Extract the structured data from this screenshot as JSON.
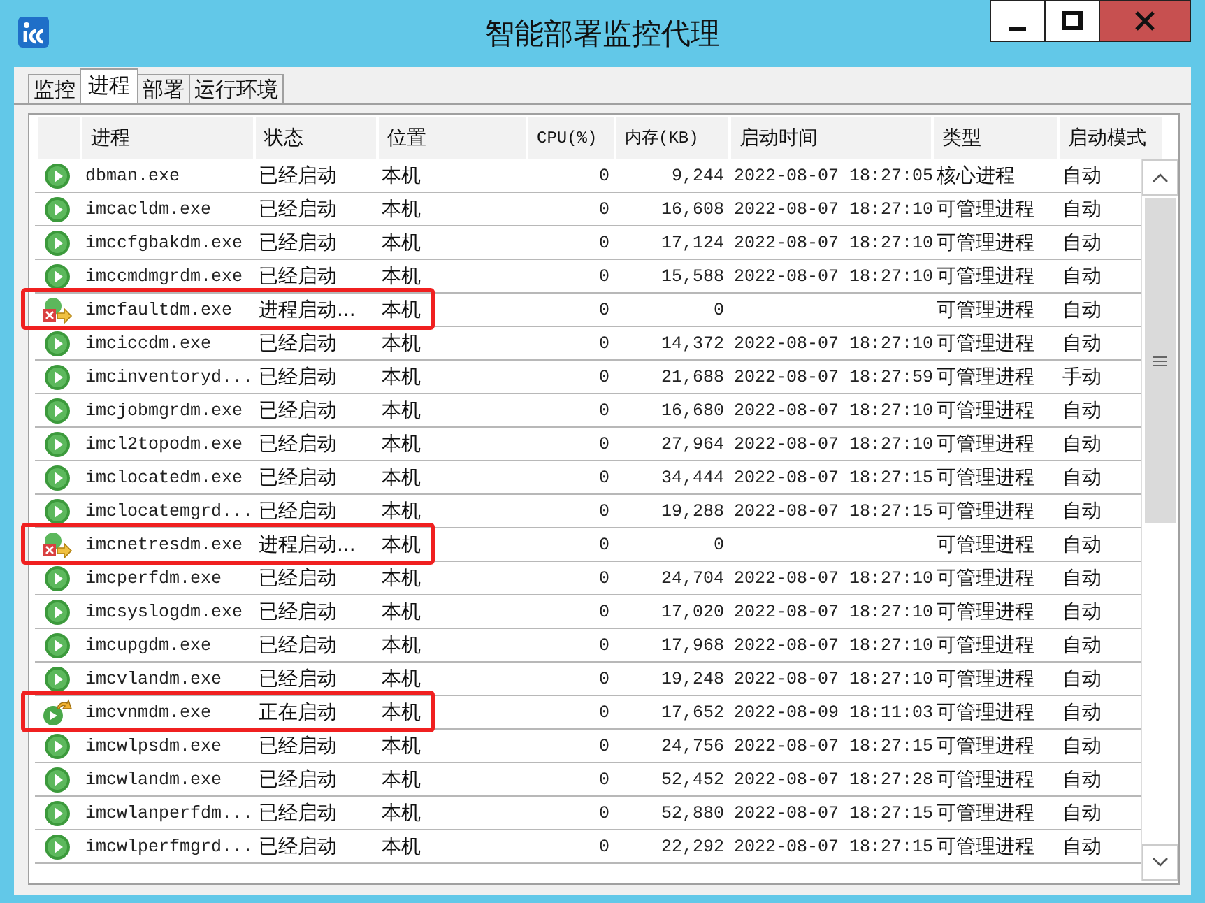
{
  "window": {
    "title": "智能部署监控代理"
  },
  "tabs": [
    {
      "label": "监控",
      "selected": false
    },
    {
      "label": "进程",
      "selected": true
    },
    {
      "label": "部署",
      "selected": false
    },
    {
      "label": "运行环境",
      "selected": false
    }
  ],
  "table": {
    "columns": [
      "进程",
      "状态",
      "位置",
      "CPU(%)",
      "内存(KB)",
      "启动时间",
      "类型",
      "启动模式"
    ],
    "rows": [
      {
        "kind": "running",
        "highlighted": false,
        "cells": [
          "dbman.exe",
          "已经启动",
          "本机",
          "0",
          "9,244",
          "2022-08-07 18:27:05",
          "核心进程",
          "自动"
        ]
      },
      {
        "kind": "running",
        "highlighted": false,
        "cells": [
          "imcacldm.exe",
          "已经启动",
          "本机",
          "0",
          "16,608",
          "2022-08-07 18:27:10",
          "可管理进程",
          "自动"
        ]
      },
      {
        "kind": "running",
        "highlighted": false,
        "cells": [
          "imccfgbakdm.exe",
          "已经启动",
          "本机",
          "0",
          "17,124",
          "2022-08-07 18:27:10",
          "可管理进程",
          "自动"
        ]
      },
      {
        "kind": "running",
        "highlighted": false,
        "cells": [
          "imccmdmgrdm.exe",
          "已经启动",
          "本机",
          "0",
          "15,588",
          "2022-08-07 18:27:10",
          "可管理进程",
          "自动"
        ]
      },
      {
        "kind": "failed",
        "highlighted": true,
        "cells": [
          "imcfaultdm.exe",
          "进程启动...",
          "本机",
          "0",
          "0",
          "",
          "可管理进程",
          "自动"
        ]
      },
      {
        "kind": "running",
        "highlighted": false,
        "cells": [
          "imciccdm.exe",
          "已经启动",
          "本机",
          "0",
          "14,372",
          "2022-08-07 18:27:10",
          "可管理进程",
          "自动"
        ]
      },
      {
        "kind": "running",
        "highlighted": false,
        "cells": [
          "imcinventoryd...",
          "已经启动",
          "本机",
          "0",
          "21,688",
          "2022-08-07 18:27:59",
          "可管理进程",
          "手动"
        ]
      },
      {
        "kind": "running",
        "highlighted": false,
        "cells": [
          "imcjobmgrdm.exe",
          "已经启动",
          "本机",
          "0",
          "16,680",
          "2022-08-07 18:27:10",
          "可管理进程",
          "自动"
        ]
      },
      {
        "kind": "running",
        "highlighted": false,
        "cells": [
          "imcl2topodm.exe",
          "已经启动",
          "本机",
          "0",
          "27,964",
          "2022-08-07 18:27:10",
          "可管理进程",
          "自动"
        ]
      },
      {
        "kind": "running",
        "highlighted": false,
        "cells": [
          "imclocatedm.exe",
          "已经启动",
          "本机",
          "0",
          "34,444",
          "2022-08-07 18:27:15",
          "可管理进程",
          "自动"
        ]
      },
      {
        "kind": "running",
        "highlighted": false,
        "cells": [
          "imclocatemgrd...",
          "已经启动",
          "本机",
          "0",
          "19,288",
          "2022-08-07 18:27:15",
          "可管理进程",
          "自动"
        ]
      },
      {
        "kind": "failed",
        "highlighted": true,
        "cells": [
          "imcnetresdm.exe",
          "进程启动...",
          "本机",
          "0",
          "0",
          "",
          "可管理进程",
          "自动"
        ]
      },
      {
        "kind": "running",
        "highlighted": false,
        "cells": [
          "imcperfdm.exe",
          "已经启动",
          "本机",
          "0",
          "24,704",
          "2022-08-07 18:27:10",
          "可管理进程",
          "自动"
        ]
      },
      {
        "kind": "running",
        "highlighted": false,
        "cells": [
          "imcsyslogdm.exe",
          "已经启动",
          "本机",
          "0",
          "17,020",
          "2022-08-07 18:27:10",
          "可管理进程",
          "自动"
        ]
      },
      {
        "kind": "running",
        "highlighted": false,
        "cells": [
          "imcupgdm.exe",
          "已经启动",
          "本机",
          "0",
          "17,968",
          "2022-08-07 18:27:10",
          "可管理进程",
          "自动"
        ]
      },
      {
        "kind": "running",
        "highlighted": false,
        "cells": [
          "imcvlandm.exe",
          "已经启动",
          "本机",
          "0",
          "19,248",
          "2022-08-07 18:27:10",
          "可管理进程",
          "自动"
        ]
      },
      {
        "kind": "starting",
        "highlighted": true,
        "cells": [
          "imcvnmdm.exe",
          "正在启动",
          "本机",
          "0",
          "17,652",
          "2022-08-09 18:11:03",
          "可管理进程",
          "自动"
        ]
      },
      {
        "kind": "running",
        "highlighted": false,
        "cells": [
          "imcwlpsdm.exe",
          "已经启动",
          "本机",
          "0",
          "24,756",
          "2022-08-07 18:27:15",
          "可管理进程",
          "自动"
        ]
      },
      {
        "kind": "running",
        "highlighted": false,
        "cells": [
          "imcwlandm.exe",
          "已经启动",
          "本机",
          "0",
          "52,452",
          "2022-08-07 18:27:28",
          "可管理进程",
          "自动"
        ]
      },
      {
        "kind": "running",
        "highlighted": false,
        "cells": [
          "imcwlanperfdm...",
          "已经启动",
          "本机",
          "0",
          "52,880",
          "2022-08-07 18:27:15",
          "可管理进程",
          "自动"
        ]
      },
      {
        "kind": "running",
        "highlighted": false,
        "cells": [
          "imcwlperfmgrd...",
          "已经启动",
          "本机",
          "0",
          "22,292",
          "2022-08-07 18:27:15",
          "可管理进程",
          "自动"
        ]
      }
    ]
  }
}
